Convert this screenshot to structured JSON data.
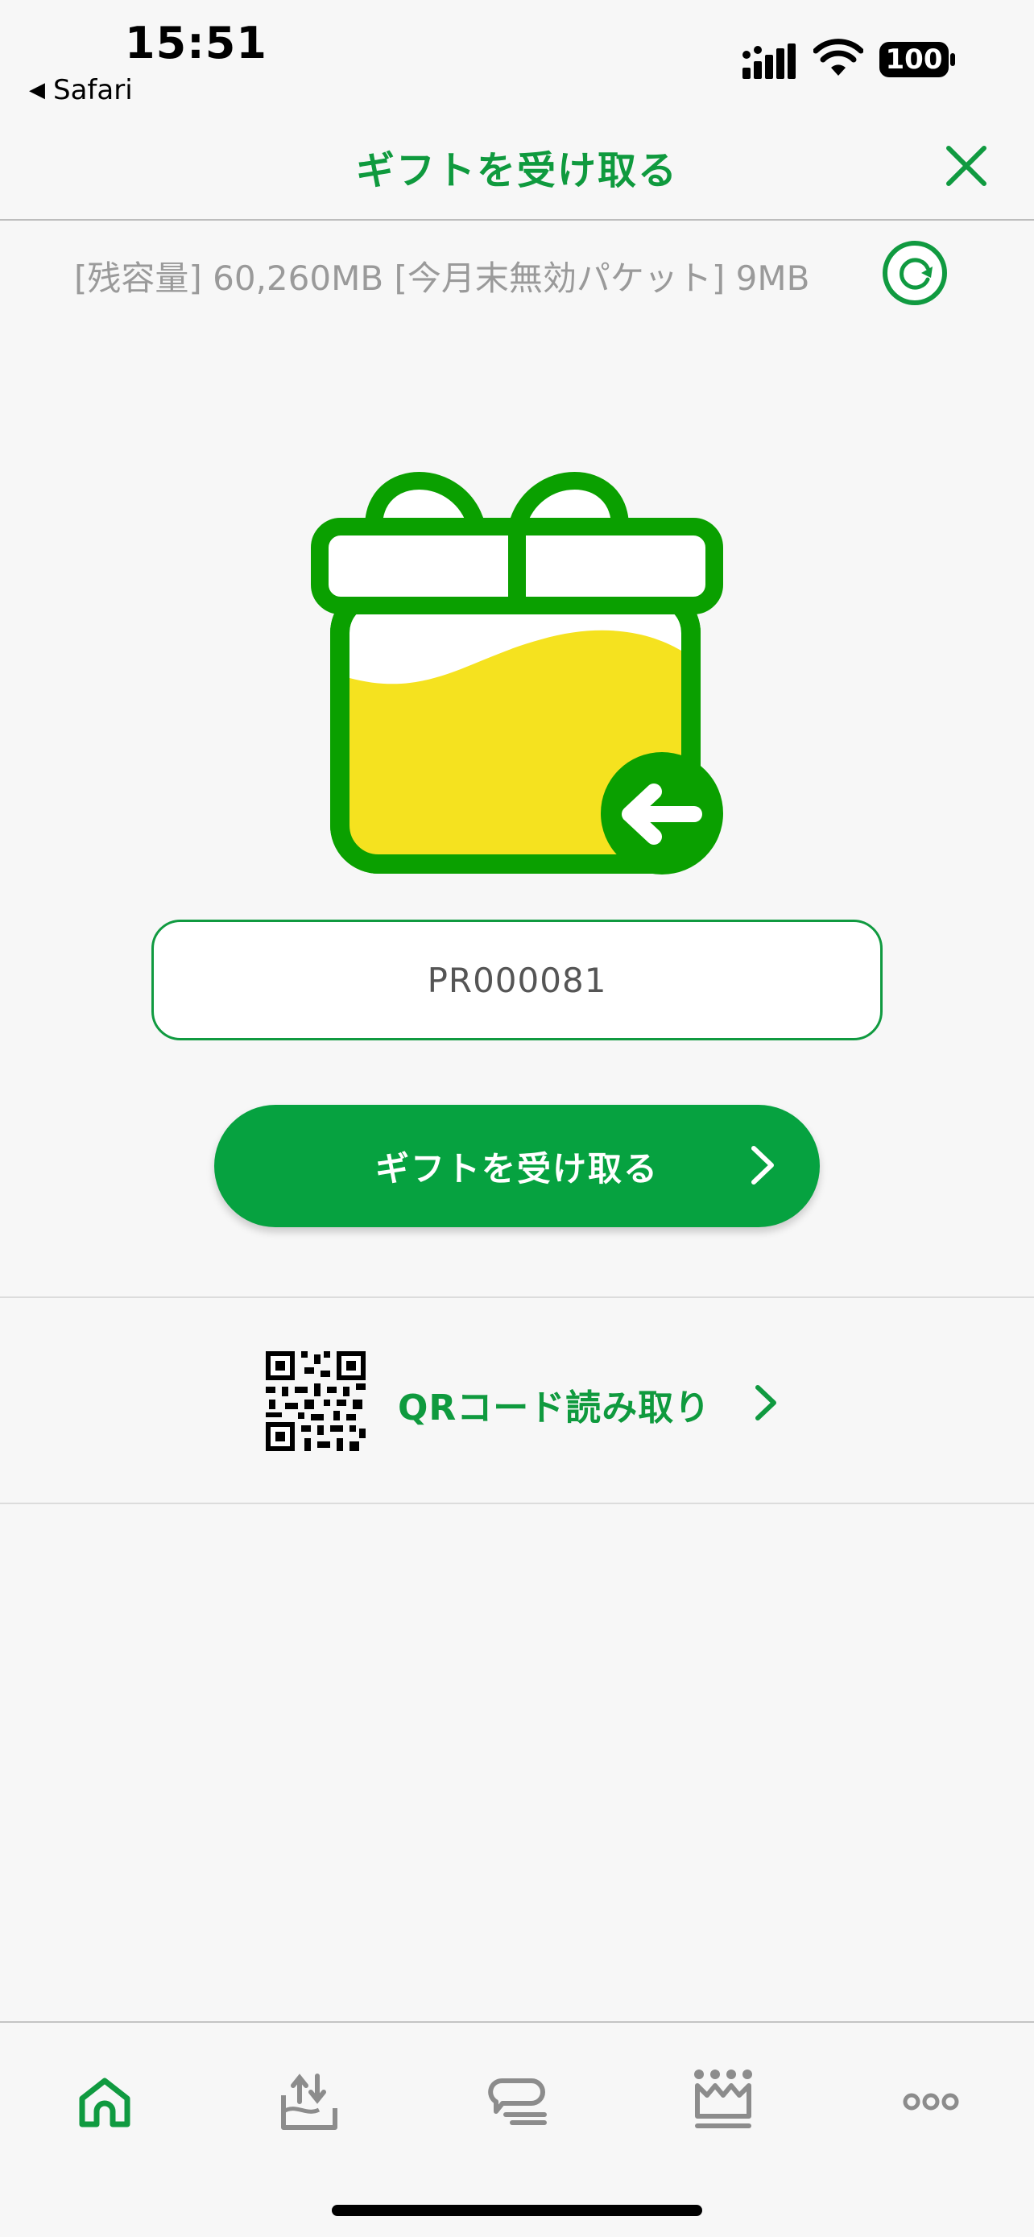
{
  "status_bar": {
    "time": "15:51",
    "back_app": "Safari",
    "battery": "100"
  },
  "header": {
    "title": "ギフトを受け取る"
  },
  "capacity": {
    "text": "[残容量] 60,260MB  [今月末無効パケット] 9MB"
  },
  "gift_code": {
    "value": "PR000081"
  },
  "receive_button": {
    "label": "ギフトを受け取る"
  },
  "qr_row": {
    "label": "QRコード読み取り"
  },
  "colors": {
    "accent_green": "#06a240",
    "text_green": "#0f9a3e",
    "gift_yellow": "#f5e21f"
  },
  "tabs": [
    "home-icon",
    "data-exchange-icon",
    "chat-icon",
    "crown-icon",
    "more-icon"
  ]
}
